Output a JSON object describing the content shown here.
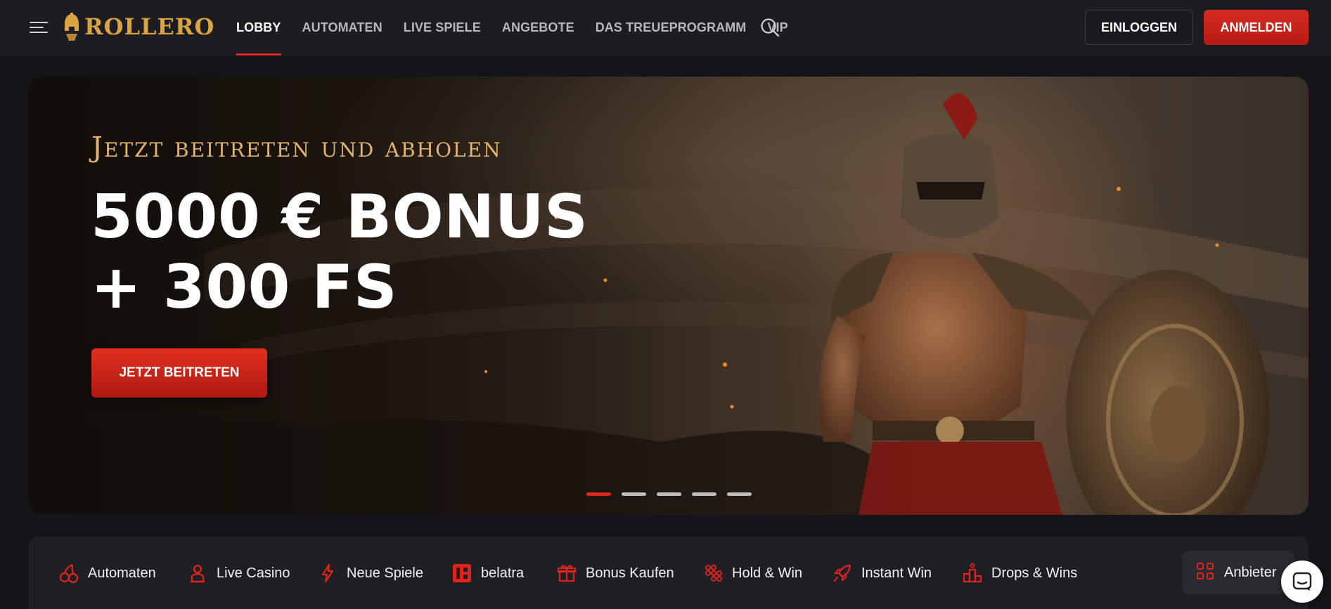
{
  "header": {
    "logo_text": "ROLLERO",
    "nav": [
      {
        "label": "LOBBY",
        "active": true
      },
      {
        "label": "AUTOMATEN",
        "active": false
      },
      {
        "label": "LIVE SPIELE",
        "active": false
      },
      {
        "label": "ANGEBOTE",
        "active": false
      },
      {
        "label": "DAS TREUEPROGRAMM",
        "active": false
      },
      {
        "label": "VIP",
        "active": false
      }
    ],
    "login_label": "EINLOGGEN",
    "register_label": "ANMELDEN"
  },
  "banner": {
    "subtitle": "Jetzt beitreten und abholen",
    "headline_line1": "5000 € BONUS",
    "headline_line2": "+ 300 FS",
    "cta_label": "JETZT BEITRETEN",
    "slides_total": 5,
    "active_slide": 1
  },
  "categories": [
    {
      "label": "Automaten",
      "icon": "cherry-icon"
    },
    {
      "label": "Live Casino",
      "icon": "dealer-icon"
    },
    {
      "label": "Neue Spiele",
      "icon": "lightning-icon"
    },
    {
      "label": "belatra",
      "icon": "belatra-logo-icon"
    },
    {
      "label": "Bonus Kaufen",
      "icon": "gift-icon"
    },
    {
      "label": "Hold & Win",
      "icon": "dots-grid-icon"
    },
    {
      "label": "Instant Win",
      "icon": "rocket-icon"
    },
    {
      "label": "Drops & Wins",
      "icon": "podium-icon"
    }
  ],
  "provider_label": "Anbieter",
  "colors": {
    "accent": "#e0241c",
    "gold": "#d9a441",
    "background": "#141419",
    "header": "#1c1c22"
  }
}
